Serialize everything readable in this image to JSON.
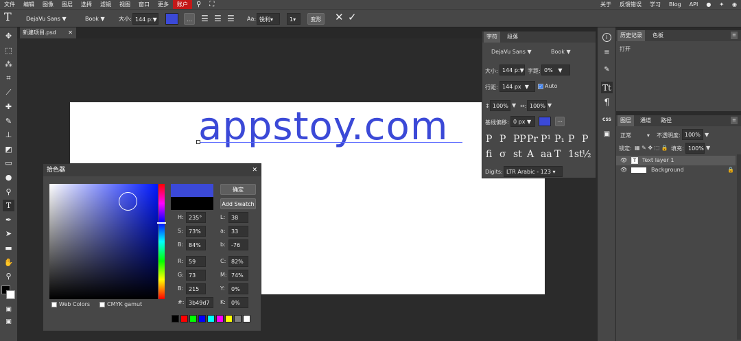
{
  "menu": {
    "items": [
      "文件",
      "编辑",
      "图像",
      "图层",
      "选择",
      "滤镜",
      "视图",
      "窗口",
      "更多"
    ],
    "account": "账户",
    "right": [
      "关于",
      "反馈错误",
      "学习",
      "Blog",
      "API"
    ]
  },
  "options": {
    "font": "DejaVu Sans",
    "style": "Book",
    "size_label": "大小:",
    "size_value": "144 p:",
    "aa_label": "Aa:",
    "aa_value": "锐利",
    "num_value": "1",
    "transform": "变形",
    "text_color": "#3b49d7"
  },
  "tab": {
    "name": "新建项目.psd"
  },
  "canvas": {
    "text": "appstoy.com"
  },
  "picker": {
    "title": "拾色器",
    "ok": "确定",
    "add_swatch": "Add Swatch",
    "hsb": [
      {
        "l": "H:",
        "v": "235°"
      },
      {
        "l": "S:",
        "v": "73%"
      },
      {
        "l": "B:",
        "v": "84%"
      }
    ],
    "lab": [
      {
        "l": "L:",
        "v": "38"
      },
      {
        "l": "a:",
        "v": "33"
      },
      {
        "l": "b:",
        "v": "-76"
      }
    ],
    "rgb": [
      {
        "l": "R:",
        "v": "59"
      },
      {
        "l": "G:",
        "v": "73"
      },
      {
        "l": "B:",
        "v": "215"
      }
    ],
    "cmyk": [
      {
        "l": "C:",
        "v": "82%"
      },
      {
        "l": "M:",
        "v": "74%"
      },
      {
        "l": "Y:",
        "v": "0%"
      },
      {
        "l": "K:",
        "v": "0%"
      }
    ],
    "hex_label": "#:",
    "hex": "3b49d7",
    "web_colors": "Web Colors",
    "cmyk_gamut": "CMYK gamut",
    "new_color": "#3b49d7",
    "old_color": "#000000",
    "swatches": [
      "#000000",
      "#ff0000",
      "#00ff00",
      "#0000ff",
      "#00ffff",
      "#ff00ff",
      "#ffff00",
      "#808080",
      "#ffffff"
    ]
  },
  "charpanel": {
    "tabs": [
      "字符",
      "段落"
    ],
    "font": "DejaVu Sans",
    "style": "Book",
    "size_label": "大小:",
    "size": "144 p:",
    "tracking_label": "字距:",
    "tracking": "0%",
    "leading_label": "行距:",
    "leading": "144 px",
    "auto": "Auto",
    "vscale": "100%",
    "hscale": "100%",
    "baseline_label": "基线偏移:",
    "baseline": "0 px",
    "digits_label": "Digits:",
    "digits": "LTR Arabic - 123",
    "glyphs1": [
      "P",
      "P",
      "PP",
      "Pr",
      "P¹",
      "P₁",
      "P",
      "P"
    ],
    "glyphs2": [
      "fi",
      "σ",
      "st",
      "A",
      "aa",
      "T",
      "1st",
      "½"
    ]
  },
  "rightcol": {
    "css": "CSS"
  },
  "history": {
    "tabs": [
      "历史记录",
      "色板"
    ],
    "items": [
      "打开"
    ]
  },
  "layers": {
    "tabs": [
      "图层",
      "通道",
      "路径"
    ],
    "blend": "正常",
    "opacity_label": "不透明度:",
    "opacity": "100%",
    "lock_label": "锁定:",
    "fill_label": "填充:",
    "fill": "100%",
    "items": [
      "Text layer 1",
      "Background"
    ]
  }
}
